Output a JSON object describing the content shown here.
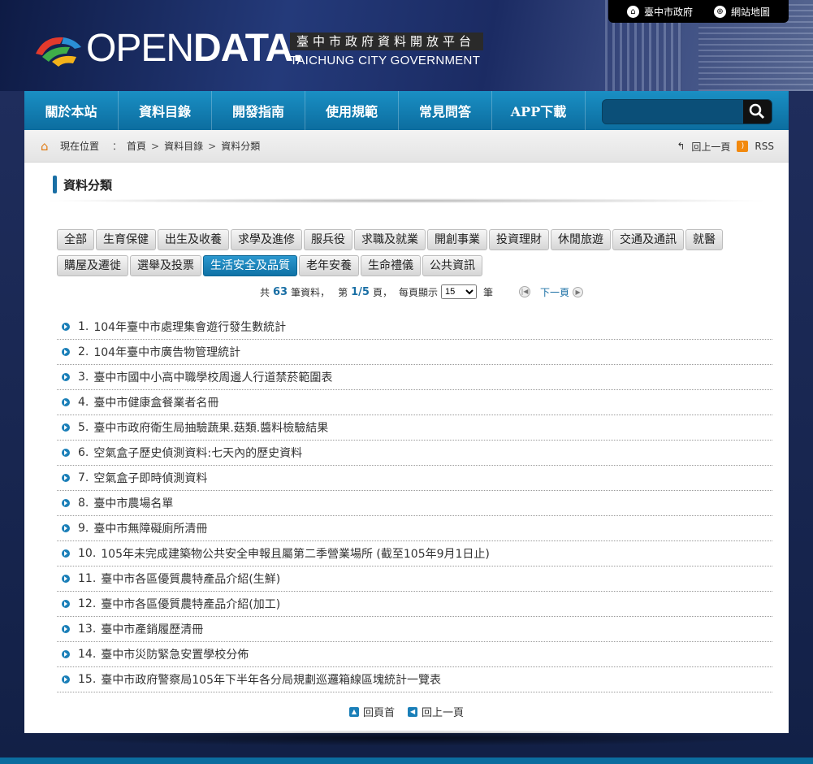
{
  "topbar": {
    "links": [
      {
        "label": "臺中市政府",
        "icon": "house-icon"
      },
      {
        "label": "網站地圖",
        "icon": "sitemap-icon"
      }
    ]
  },
  "logo": {
    "main_light": "OPEN",
    "main_bold": "DATA.",
    "subtitle_zh": "臺中市政府資料開放平台",
    "subtitle_en": "TAICHUNG CITY GOVERNMENT"
  },
  "nav": {
    "items": [
      "關於本站",
      "資料目錄",
      "開發指南",
      "使用規範",
      "常見問答",
      "APP下載"
    ],
    "search_value": ""
  },
  "breadcrumb": {
    "here": "現在位置",
    "path": [
      "首頁",
      "資料目錄",
      "資料分類"
    ],
    "back": "回上一頁",
    "rss": "RSS"
  },
  "section": {
    "title": "資料分類"
  },
  "tags": [
    "全部",
    "生育保健",
    "出生及收養",
    "求學及進修",
    "服兵役",
    "求職及就業",
    "開創事業",
    "投資理財",
    "休閒旅遊",
    "交通及通訊",
    "就醫",
    "購屋及遷徙",
    "選舉及投票",
    "生活安全及品質",
    "老年安養",
    "生命禮儀",
    "公共資訊"
  ],
  "active_tag": "生活安全及品質",
  "pager": {
    "prefix": "共",
    "total": "63",
    "unit_records": "筆資料，",
    "page_prefix": "第",
    "page": "1/5",
    "page_suffix": "頁，",
    "per_page_label": "每頁顯示",
    "per_page": "15",
    "per_page_unit": "筆",
    "next": "下一頁"
  },
  "items": [
    {
      "idx": "1.",
      "title": "104年臺中市處理集會遊行發生數統計"
    },
    {
      "idx": "2.",
      "title": "104年臺中市廣告物管理統計"
    },
    {
      "idx": "3.",
      "title": "臺中市國中小高中職學校周邊人行道禁菸範圍表"
    },
    {
      "idx": "4.",
      "title": "臺中市健康盒餐業者名冊"
    },
    {
      "idx": "5.",
      "title": "臺中市政府衛生局抽驗蔬果.菇類.醬料檢驗結果"
    },
    {
      "idx": "6.",
      "title": "空氣盒子歷史偵測資料:七天內的歷史資料"
    },
    {
      "idx": "7.",
      "title": "空氣盒子即時偵測資料"
    },
    {
      "idx": "8.",
      "title": "臺中市農場名單"
    },
    {
      "idx": "9.",
      "title": "臺中市無障礙廁所清冊"
    },
    {
      "idx": "10.",
      "title": "105年未完成建築物公共安全申報且屬第二季營業場所 (截至105年9月1日止)"
    },
    {
      "idx": "11.",
      "title": "臺中市各區優質農特產品介紹(生鮮)"
    },
    {
      "idx": "12.",
      "title": "臺中市各區優質農特產品介紹(加工)"
    },
    {
      "idx": "13.",
      "title": "臺中市產銷履歷清冊"
    },
    {
      "idx": "14.",
      "title": "臺中市災防緊急安置學校分佈"
    },
    {
      "idx": "15.",
      "title": "臺中市政府警察局105年下半年各分局規劃巡邏箱線區塊統計一覽表"
    }
  ],
  "bottom": {
    "top": "回頁首",
    "back": "回上一頁"
  },
  "colors": {
    "nav": "#1a8fc4",
    "accent": "#1a6fa5",
    "active_tag": "#2b98cf"
  }
}
